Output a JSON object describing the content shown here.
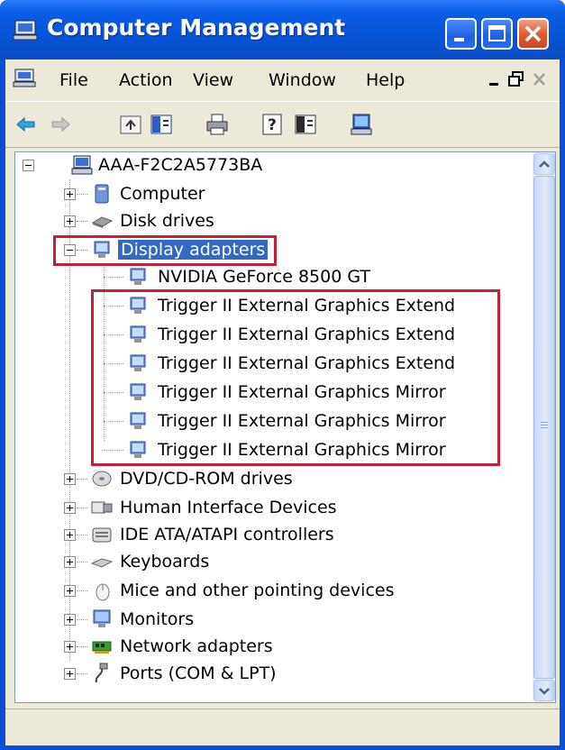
{
  "window": {
    "title": "Computer Management",
    "icon": "computer-management-icon",
    "controls": [
      "minimize-icon",
      "maximize-icon",
      "close-icon"
    ]
  },
  "menu": {
    "items": [
      "File",
      "Action",
      "View",
      "Window",
      "Help"
    ]
  },
  "toolbar": {
    "buttons": [
      "back-arrow-icon",
      "forward-arrow-icon",
      "up-folder-icon",
      "show-hide-tree-icon",
      "print-icon",
      "help-icon",
      "properties-pane-icon",
      "monitor-scan-icon"
    ]
  },
  "tree": {
    "root": "AAA-F2C2A5773BA",
    "categories_before": [
      "Computer",
      "Disk drives"
    ],
    "expanded": "Display adapters",
    "adapters": [
      "NVIDIA GeForce 8500 GT",
      "Trigger II External Graphics Extend",
      "Trigger II External Graphics Extend",
      "Trigger II External Graphics Extend",
      "Trigger II External Graphics Mirror",
      "Trigger II External Graphics Mirror",
      "Trigger II External Graphics Mirror"
    ],
    "categories_after": [
      "DVD/CD-ROM drives",
      "Human Interface Devices",
      "IDE ATA/ATAPI controllers",
      "Keyboards",
      "Mice and other pointing devices",
      "Monitors",
      "Network adapters",
      "Ports (COM & LPT)"
    ]
  },
  "colors": {
    "title_bar": "#0755d9",
    "selection": "#316ac5",
    "highlight_box": "#c0203a"
  }
}
